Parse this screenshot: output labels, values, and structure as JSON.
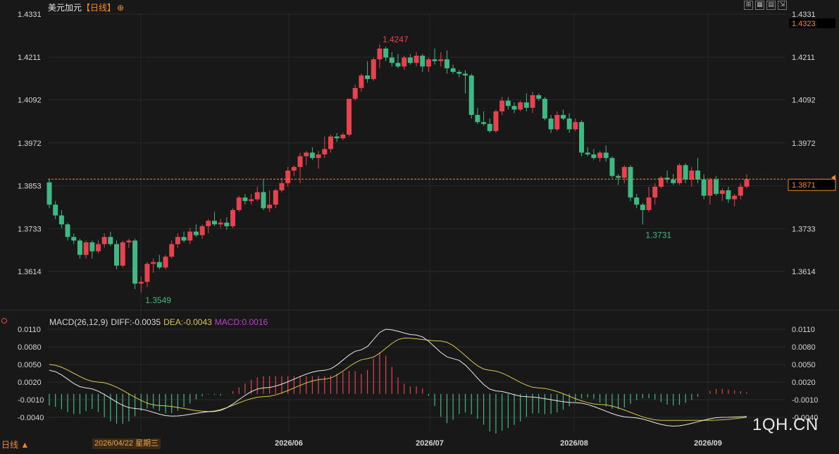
{
  "header": {
    "instrument": "美元加元",
    "period_tag": "【日线】",
    "target_icon": "crosshair-icon"
  },
  "window_controls": [
    {
      "icon": "maximize-icon",
      "glyph": "⊞"
    },
    {
      "icon": "grid-icon",
      "glyph": "▦"
    },
    {
      "icon": "layout-icon",
      "glyph": "▤"
    },
    {
      "icon": "resize-icon",
      "glyph": "⇲"
    }
  ],
  "footer": {
    "period_tab": "日线 ▲",
    "cursor_date": "2026/04/22 星期三",
    "watermark": "1QH.CN"
  },
  "colors": {
    "up": "#e5434f",
    "down": "#3fb884",
    "diff_line": "#e8e8e8",
    "dea_line": "#d8c64a",
    "macd_label": "#c23bd4",
    "price_line": "#f08a2c",
    "high_label": "#e5434f",
    "low_label": "#3fb884"
  },
  "chart_data": [
    {
      "type": "candlestick",
      "title": "美元加元【日线】",
      "ylim": [
        1.3549,
        1.4331
      ],
      "y_ticks": [
        "1.4331",
        "1.4211",
        "1.4092",
        "1.3972",
        "1.3853",
        "1.3733",
        "1.3614"
      ],
      "last_price": 1.3871,
      "last_price_label": "1.3871",
      "top_label": "1.4323",
      "max_label": {
        "value": 1.4247,
        "text": "1.4247"
      },
      "min_labels": [
        {
          "value": 1.3549,
          "text": "1.3549"
        },
        {
          "value": 1.3731,
          "text": "1.3731"
        }
      ],
      "x_labels": [
        "2026/06",
        "2026/07",
        "2026/08",
        "2026/09"
      ],
      "candles": [
        [
          1.3862,
          1.3872,
          1.379,
          1.38
        ],
        [
          1.38,
          1.381,
          1.376,
          1.377
        ],
        [
          1.377,
          1.3785,
          1.3735,
          1.3745
        ],
        [
          1.3745,
          1.375,
          1.37,
          1.371
        ],
        [
          1.371,
          1.372,
          1.369,
          1.37
        ],
        [
          1.37,
          1.3705,
          1.365,
          1.366
        ],
        [
          1.366,
          1.37,
          1.365,
          1.3695
        ],
        [
          1.3695,
          1.37,
          1.365,
          1.367
        ],
        [
          1.367,
          1.37,
          1.3665,
          1.369
        ],
        [
          1.369,
          1.372,
          1.368,
          1.371
        ],
        [
          1.371,
          1.3725,
          1.3685,
          1.369
        ],
        [
          1.369,
          1.37,
          1.362,
          1.363
        ],
        [
          1.363,
          1.37,
          1.3625,
          1.3695
        ],
        [
          1.3695,
          1.3705,
          1.368,
          1.37
        ],
        [
          1.37,
          1.3705,
          1.3565,
          1.358
        ],
        [
          1.358,
          1.36,
          1.3555,
          1.3585
        ],
        [
          1.3585,
          1.364,
          1.357,
          1.3635
        ],
        [
          1.3635,
          1.365,
          1.361,
          1.364
        ],
        [
          1.364,
          1.366,
          1.362,
          1.3625
        ],
        [
          1.3625,
          1.366,
          1.362,
          1.3655
        ],
        [
          1.3655,
          1.37,
          1.365,
          1.369
        ],
        [
          1.369,
          1.372,
          1.368,
          1.371
        ],
        [
          1.371,
          1.3725,
          1.3695,
          1.37
        ],
        [
          1.37,
          1.3735,
          1.369,
          1.3725
        ],
        [
          1.3725,
          1.3745,
          1.371,
          1.3715
        ],
        [
          1.3715,
          1.3745,
          1.3705,
          1.374
        ],
        [
          1.374,
          1.376,
          1.372,
          1.3755
        ],
        [
          1.3755,
          1.378,
          1.374,
          1.3745
        ],
        [
          1.3745,
          1.376,
          1.3735,
          1.375
        ],
        [
          1.375,
          1.3765,
          1.373,
          1.374
        ],
        [
          1.374,
          1.379,
          1.3735,
          1.3785
        ],
        [
          1.3785,
          1.3825,
          1.378,
          1.382
        ],
        [
          1.382,
          1.383,
          1.38,
          1.381
        ],
        [
          1.381,
          1.383,
          1.38,
          1.3815
        ],
        [
          1.3815,
          1.385,
          1.381,
          1.3835
        ],
        [
          1.3835,
          1.387,
          1.3785,
          1.379
        ],
        [
          1.379,
          1.384,
          1.378,
          1.38
        ],
        [
          1.38,
          1.3845,
          1.379,
          1.384
        ],
        [
          1.384,
          1.3875,
          1.3835,
          1.386
        ],
        [
          1.386,
          1.3905,
          1.385,
          1.3895
        ],
        [
          1.3895,
          1.391,
          1.388,
          1.3905
        ],
        [
          1.3905,
          1.3945,
          1.386,
          1.3935
        ],
        [
          1.3935,
          1.395,
          1.391,
          1.3945
        ],
        [
          1.3945,
          1.396,
          1.3925,
          1.393
        ],
        [
          1.393,
          1.395,
          1.39,
          1.394
        ],
        [
          1.394,
          1.399,
          1.393,
          1.3955
        ],
        [
          1.3955,
          1.3995,
          1.3945,
          1.399
        ],
        [
          1.399,
          1.4,
          1.3975,
          1.3985
        ],
        [
          1.3985,
          1.4,
          1.398,
          1.3995
        ],
        [
          1.3995,
          1.4095,
          1.399,
          1.4095
        ],
        [
          1.4095,
          1.4135,
          1.409,
          1.4125
        ],
        [
          1.4125,
          1.4165,
          1.4115,
          1.416
        ],
        [
          1.416,
          1.42,
          1.414,
          1.415
        ],
        [
          1.415,
          1.421,
          1.4145,
          1.4205
        ],
        [
          1.4205,
          1.4247,
          1.418,
          1.4235
        ],
        [
          1.4235,
          1.424,
          1.42,
          1.421
        ],
        [
          1.421,
          1.4225,
          1.4185,
          1.4195
        ],
        [
          1.4195,
          1.422,
          1.418,
          1.4185
        ],
        [
          1.4185,
          1.4215,
          1.4175,
          1.421
        ],
        [
          1.421,
          1.422,
          1.419,
          1.4195
        ],
        [
          1.4195,
          1.4225,
          1.4185,
          1.4215
        ],
        [
          1.4215,
          1.422,
          1.417,
          1.4185
        ],
        [
          1.4185,
          1.421,
          1.417,
          1.4205
        ],
        [
          1.4205,
          1.4235,
          1.419,
          1.42
        ],
        [
          1.42,
          1.4225,
          1.4185,
          1.4205
        ],
        [
          1.4205,
          1.423,
          1.4165,
          1.418
        ],
        [
          1.418,
          1.419,
          1.4165,
          1.417
        ],
        [
          1.417,
          1.4175,
          1.4155,
          1.4165
        ],
        [
          1.4165,
          1.4175,
          1.411,
          1.416
        ],
        [
          1.416,
          1.4165,
          1.404,
          1.405
        ],
        [
          1.405,
          1.407,
          1.4025,
          1.403
        ],
        [
          1.403,
          1.406,
          1.402,
          1.4025
        ],
        [
          1.4025,
          1.404,
          1.4,
          1.4005
        ],
        [
          1.4005,
          1.4065,
          1.4,
          1.406
        ],
        [
          1.406,
          1.41,
          1.405,
          1.409
        ],
        [
          1.409,
          1.41,
          1.4065,
          1.4075
        ],
        [
          1.4075,
          1.4085,
          1.4055,
          1.4065
        ],
        [
          1.4065,
          1.409,
          1.406,
          1.4085
        ],
        [
          1.4085,
          1.411,
          1.406,
          1.407
        ],
        [
          1.407,
          1.4115,
          1.4055,
          1.4105
        ],
        [
          1.4105,
          1.411,
          1.409,
          1.4095
        ],
        [
          1.4095,
          1.41,
          1.4035,
          1.404
        ],
        [
          1.404,
          1.405,
          1.4,
          1.401
        ],
        [
          1.401,
          1.406,
          1.4005,
          1.405
        ],
        [
          1.405,
          1.4065,
          1.4035,
          1.404
        ],
        [
          1.404,
          1.4055,
          1.4,
          1.401
        ],
        [
          1.401,
          1.404,
          1.4005,
          1.403
        ],
        [
          1.403,
          1.4035,
          1.3935,
          1.3945
        ],
        [
          1.3945,
          1.396,
          1.3935,
          1.394
        ],
        [
          1.394,
          1.3955,
          1.3925,
          1.393
        ],
        [
          1.393,
          1.395,
          1.392,
          1.3945
        ],
        [
          1.3945,
          1.3965,
          1.392,
          1.393
        ],
        [
          1.393,
          1.3935,
          1.3875,
          1.388
        ],
        [
          1.388,
          1.3885,
          1.3855,
          1.3875
        ],
        [
          1.3875,
          1.391,
          1.386,
          1.3905
        ],
        [
          1.3905,
          1.391,
          1.381,
          1.382
        ],
        [
          1.382,
          1.383,
          1.379,
          1.38
        ],
        [
          1.38,
          1.3805,
          1.3745,
          1.3785
        ],
        [
          1.3785,
          1.385,
          1.378,
          1.382
        ],
        [
          1.382,
          1.386,
          1.38,
          1.385
        ],
        [
          1.385,
          1.388,
          1.3845,
          1.3875
        ],
        [
          1.3875,
          1.3895,
          1.386,
          1.387
        ],
        [
          1.387,
          1.3885,
          1.3855,
          1.386
        ],
        [
          1.386,
          1.3915,
          1.3855,
          1.391
        ],
        [
          1.391,
          1.3915,
          1.386,
          1.387
        ],
        [
          1.387,
          1.3905,
          1.385,
          1.3895
        ],
        [
          1.3895,
          1.393,
          1.386,
          1.387
        ],
        [
          1.387,
          1.3885,
          1.3815,
          1.3825
        ],
        [
          1.3825,
          1.3875,
          1.38,
          1.387
        ],
        [
          1.387,
          1.388,
          1.3825,
          1.383
        ],
        [
          1.383,
          1.3845,
          1.381,
          1.384
        ],
        [
          1.384,
          1.385,
          1.3805,
          1.3815
        ],
        [
          1.3815,
          1.383,
          1.3795,
          1.3825
        ],
        [
          1.3825,
          1.386,
          1.3815,
          1.385
        ],
        [
          1.385,
          1.3885,
          1.3845,
          1.3871
        ]
      ]
    },
    {
      "type": "line",
      "title": "MACD(26,12,9)",
      "legend": {
        "name": "MACD(26,12,9)",
        "diff": "DIFF:-0.0035",
        "dea": "DEA:-0.0043",
        "macd": "MACD:0.0016"
      },
      "ylim": [
        -0.0055,
        0.0115
      ],
      "y_ticks": [
        "0.0110",
        "0.0080",
        "0.0050",
        "0.0020",
        "-0.0010",
        "-0.0040"
      ],
      "diff_control": [
        [
          0,
          0.004
        ],
        [
          6,
          0.001
        ],
        [
          14,
          -0.0025
        ],
        [
          20,
          -0.0038
        ],
        [
          27,
          -0.003
        ],
        [
          35,
          0.001
        ],
        [
          45,
          0.004
        ],
        [
          51,
          0.0075
        ],
        [
          55,
          0.011
        ],
        [
          60,
          0.01
        ],
        [
          66,
          0.006
        ],
        [
          73,
          0.0005
        ],
        [
          78,
          -0.0005
        ],
        [
          86,
          -0.0015
        ],
        [
          95,
          -0.004
        ],
        [
          102,
          -0.0055
        ],
        [
          110,
          -0.004
        ],
        [
          116,
          -0.0038
        ],
        [
          120,
          -0.0025
        ]
      ],
      "dea_control": [
        [
          0,
          0.005
        ],
        [
          8,
          0.002
        ],
        [
          18,
          -0.002
        ],
        [
          26,
          -0.003
        ],
        [
          35,
          -0.0005
        ],
        [
          45,
          0.0025
        ],
        [
          52,
          0.006
        ],
        [
          58,
          0.0095
        ],
        [
          64,
          0.009
        ],
        [
          72,
          0.004
        ],
        [
          80,
          0.001
        ],
        [
          90,
          -0.0018
        ],
        [
          100,
          -0.0045
        ],
        [
          108,
          -0.0045
        ],
        [
          120,
          -0.0035
        ]
      ]
    }
  ]
}
